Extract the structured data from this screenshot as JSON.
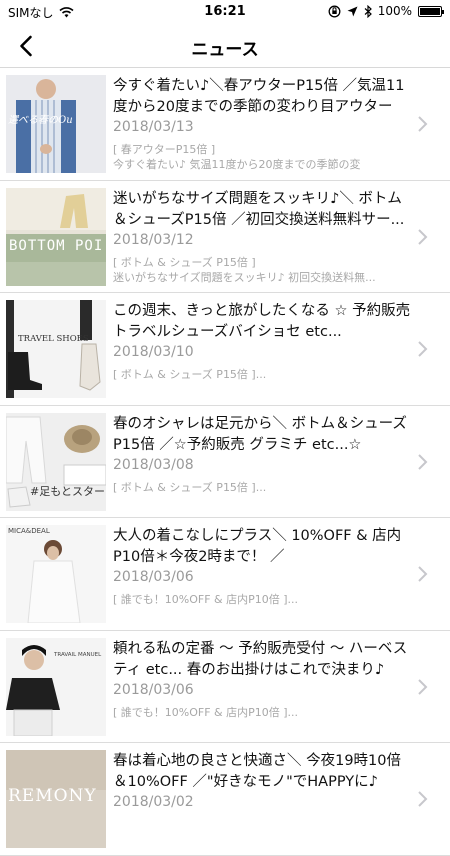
{
  "status": {
    "carrier": "SIMなし",
    "time": "16:21",
    "battery": "100%"
  },
  "nav": {
    "title": "ニュース"
  },
  "items": [
    {
      "title": "今すぐ着たい♪＼春アウターP15倍 ／気温11度から20度までの季節の変わり目アウター",
      "date": "2018/03/13",
      "tag": "[ 春アウターP15倍 ]",
      "desc": "今すぐ着たい♪ 気温11度から20度までの季節の変",
      "thumb_text": "選べる春のOu"
    },
    {
      "title": "迷いがちなサイズ問題をスッキリ♪＼ ボトム＆シューズP15倍 ／初回交換送料無料サー...",
      "date": "2018/03/12",
      "tag": "[ ボトム & シューズ P15倍 ]",
      "desc": "迷いがちなサイズ問題をスッキリ♪ 初回交換送料無...",
      "thumb_text": "BOTTOM POI"
    },
    {
      "title": "この週末、きっと旅がしたくなる ☆ 予約販売 トラベルシューズバイショセ etc...",
      "date": "2018/03/10",
      "tag": "[ ボトム & シューズ P15倍 ]...",
      "desc": "",
      "thumb_text": "TRAVEL SHOES"
    },
    {
      "title": "春のオシャレは足元から＼ ボトム＆シューズP15倍 ／☆予約販売 グラミチ etc...☆",
      "date": "2018/03/08",
      "tag": "[ ボトム & シューズ P15倍 ]...",
      "desc": "",
      "thumb_text": "#足もとスター"
    },
    {
      "title": "大人の着こなしにプラス＼ 10%OFF & 店内P10倍＊今夜2時まで！ ／",
      "date": "2018/03/06",
      "tag": "[ 誰でも！10%OFF & 店内P10倍 ]...",
      "desc": "",
      "thumb_text": "MICA&DEAL"
    },
    {
      "title": "頼れる私の定番 〜 予約販売受付 〜 ハーベスティ etc... 春のお出掛けはこれで決まり♪",
      "date": "2018/03/06",
      "tag": "[ 誰でも！10%OFF & 店内P10倍 ]...",
      "desc": "",
      "thumb_text": "TRAVAIL MANUEL"
    },
    {
      "title": "春は着心地の良さと快適さ＼ 今夜19時10倍＆10%OFF ／\"好きなモノ\"でHAPPYに♪",
      "date": "2018/03/02",
      "tag": "",
      "desc": "",
      "thumb_text": "REMONY"
    }
  ],
  "colors": {
    "date": "#9a9a9a",
    "tag": "#a8a8a8",
    "chevron": "#c7c7cc"
  }
}
